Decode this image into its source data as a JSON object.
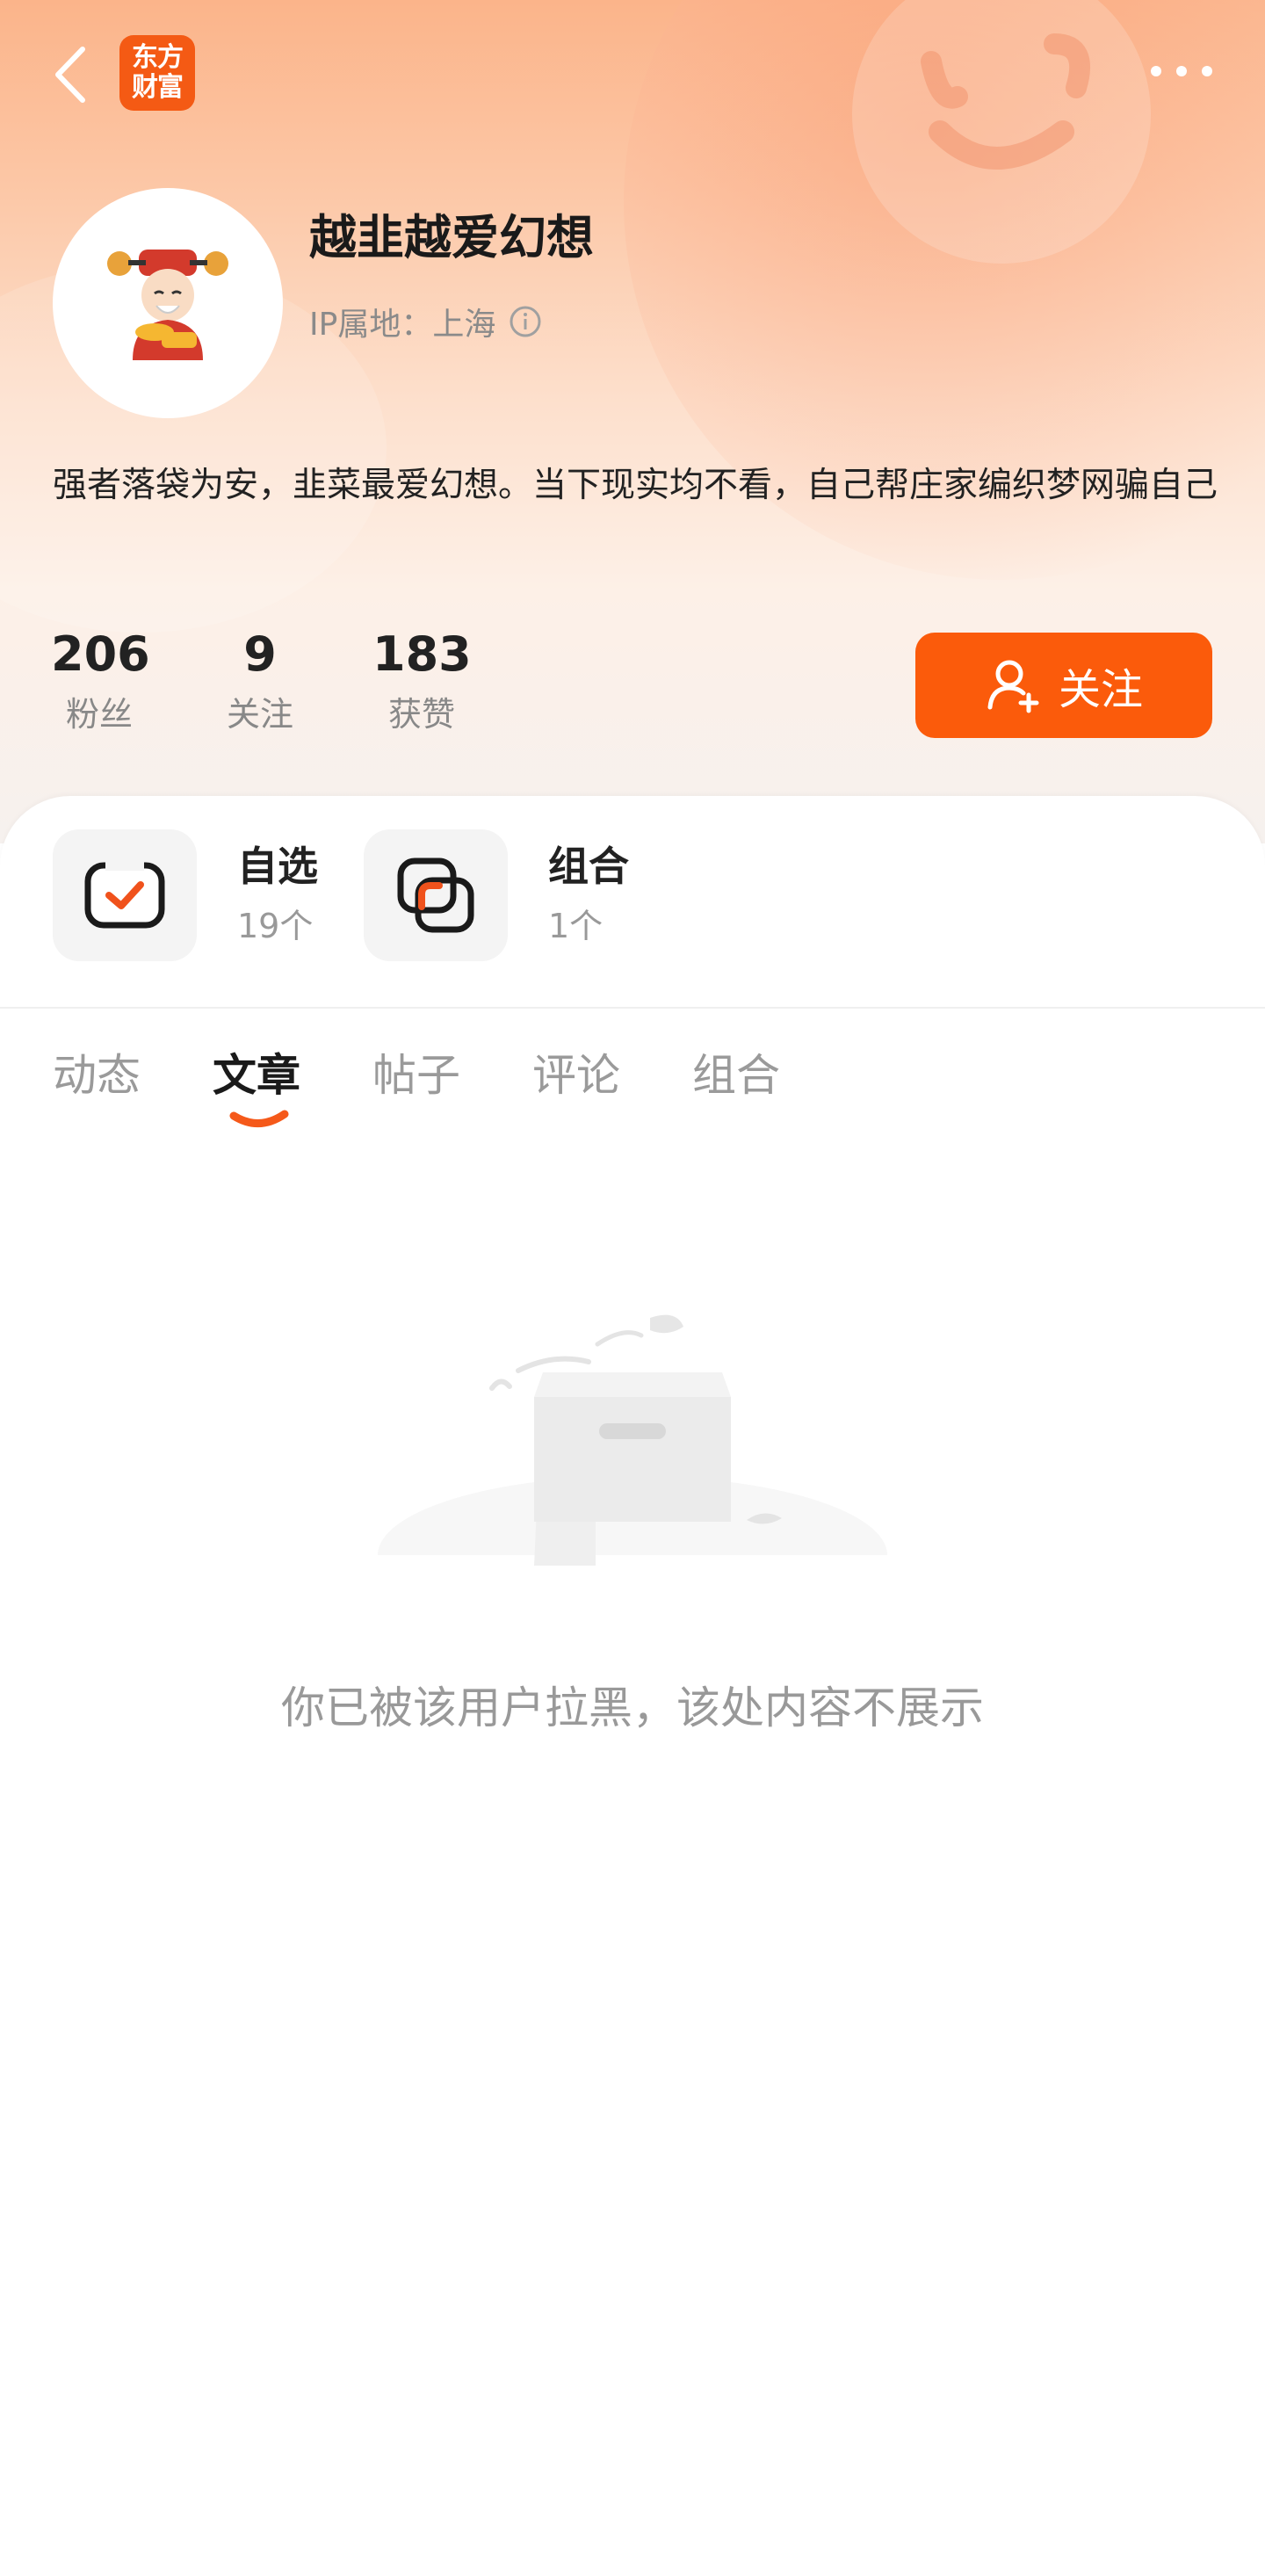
{
  "header": {
    "logo_text_line1": "东方",
    "logo_text_line2": "财富"
  },
  "profile": {
    "username": "越韭越爱幻想",
    "ip_location": "IP属地：上海",
    "bio": "强者落袋为安，韭菜最爱幻想。当下现实均不看，自己帮庄家编织梦网骗自己"
  },
  "stats": [
    {
      "value": "206",
      "label": "粉丝"
    },
    {
      "value": "9",
      "label": "关注"
    },
    {
      "value": "183",
      "label": "获赞"
    }
  ],
  "follow_button": {
    "label": "关注"
  },
  "cards": [
    {
      "title": "自选",
      "count": "19个"
    },
    {
      "title": "组合",
      "count": "1个"
    }
  ],
  "tabs": [
    {
      "label": "动态"
    },
    {
      "label": "文章",
      "active": true
    },
    {
      "label": "帖子"
    },
    {
      "label": "评论"
    },
    {
      "label": "组合"
    }
  ],
  "empty_state": {
    "message": "你已被该用户拉黑，该处内容不展示"
  },
  "colors": {
    "accent": "#fb5b0b",
    "logo_bg": "#f45a14"
  }
}
